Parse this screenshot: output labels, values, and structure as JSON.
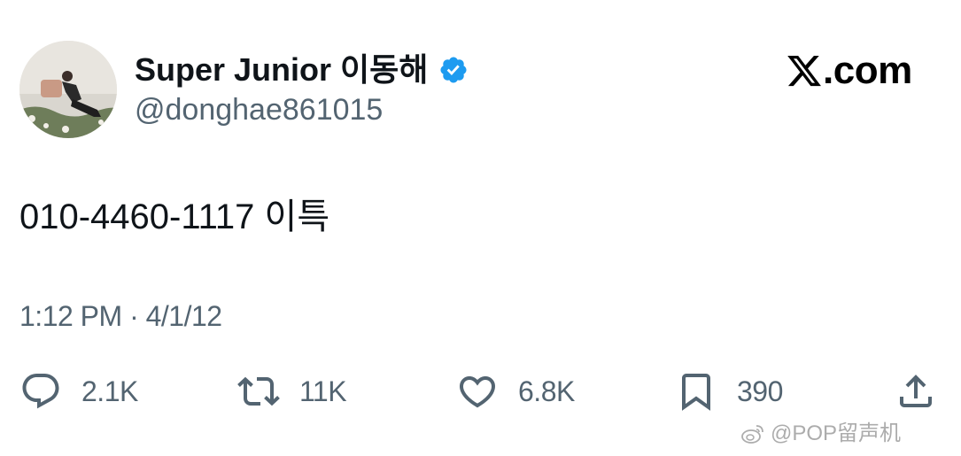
{
  "header": {
    "display_name": "Super Junior 이동해",
    "handle": "@donghae861015",
    "verified_icon": "verified-badge-icon",
    "verified_color": "#1d9bf0",
    "brand_text": ".com",
    "brand_icon": "x-logo-icon"
  },
  "tweet": {
    "text": "010-4460-1117 이특",
    "timestamp": "1:12 PM · 4/1/12"
  },
  "actions": {
    "reply": {
      "icon": "reply-icon",
      "count": "2.1K"
    },
    "retweet": {
      "icon": "retweet-icon",
      "count": "11K"
    },
    "like": {
      "icon": "heart-icon",
      "count": "6.8K"
    },
    "bookmark": {
      "icon": "bookmark-icon",
      "count": "390"
    },
    "share": {
      "icon": "share-icon"
    }
  },
  "watermark": {
    "icon": "weibo-icon",
    "text": "@POP留声机"
  },
  "colors": {
    "text_primary": "#0f1419",
    "text_secondary": "#536471"
  }
}
